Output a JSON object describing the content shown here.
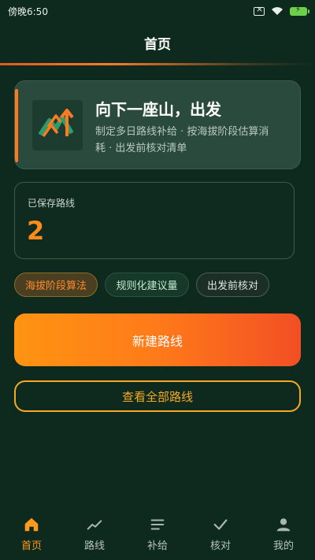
{
  "status": {
    "time": "傍晚6:50"
  },
  "header": {
    "title": "首页"
  },
  "hero": {
    "title": "向下一座山，出发",
    "desc_line1": "制定多日路线补给 · 按海拔阶段估算消",
    "desc_line2": "耗 · 出发前核对清单"
  },
  "saved": {
    "label": "已保存路线",
    "count": "2"
  },
  "chips": [
    {
      "label": "海拔阶段算法"
    },
    {
      "label": "规则化建议量"
    },
    {
      "label": "出发前核对"
    }
  ],
  "actions": {
    "new_route": "新建路线",
    "view_all": "查看全部路线"
  },
  "tabs": [
    {
      "label": "首页",
      "icon": "home-icon"
    },
    {
      "label": "路线",
      "icon": "trend-icon"
    },
    {
      "label": "补给",
      "icon": "list-icon"
    },
    {
      "label": "核对",
      "icon": "check-icon"
    },
    {
      "label": "我的",
      "icon": "person-icon"
    }
  ],
  "colors": {
    "accent": "#ff8c1a",
    "background": "#0e2a1e"
  }
}
